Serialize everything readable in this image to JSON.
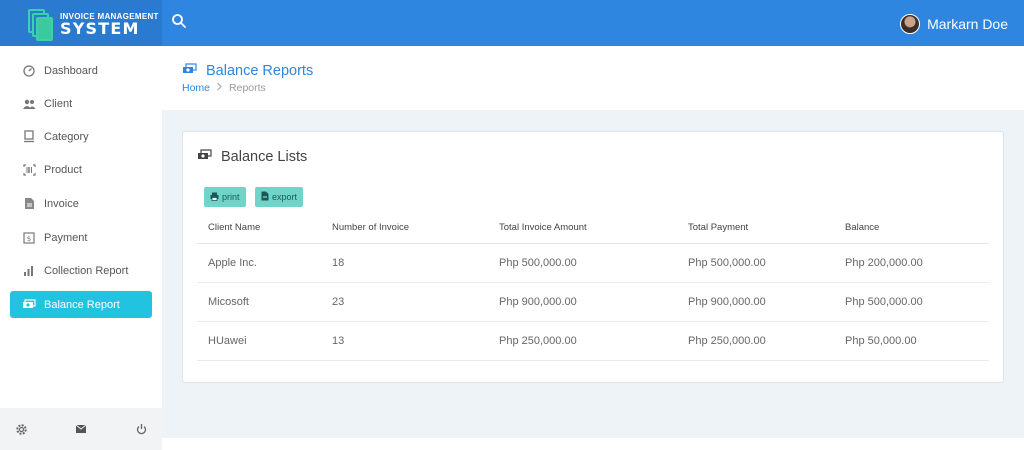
{
  "app": {
    "logo_line1": "Invoice Management",
    "logo_line2": "System"
  },
  "user": {
    "name": "Markarn Doe"
  },
  "sidebar": {
    "items": [
      {
        "label": "Dashboard",
        "icon": "dashboard-icon"
      },
      {
        "label": "Client",
        "icon": "users-icon"
      },
      {
        "label": "Category",
        "icon": "category-icon"
      },
      {
        "label": "Product",
        "icon": "barcode-icon"
      },
      {
        "label": "Invoice",
        "icon": "invoice-icon"
      },
      {
        "label": "Payment",
        "icon": "payment-icon"
      },
      {
        "label": "Collection Report",
        "icon": "chart-icon"
      },
      {
        "label": "Balance Report",
        "icon": "money-icon",
        "active": true
      }
    ],
    "footer_icons": [
      "gear-icon",
      "mail-icon",
      "power-icon"
    ]
  },
  "page": {
    "title": "Balance Reports",
    "breadcrumb_home": "Home",
    "breadcrumb_current": "Reports"
  },
  "card": {
    "title": "Balance Lists",
    "print_label": "print",
    "export_label": "export"
  },
  "table": {
    "headers": [
      "Client Name",
      "Number of Invoice",
      "Total Invoice Amount",
      "Total Payment",
      "Balance"
    ],
    "rows": [
      [
        "Apple Inc.",
        "18",
        "Php 500,000.00",
        "Php 500,000.00",
        "Php 200,000.00"
      ],
      [
        "Micosoft",
        "23",
        "Php 900,000.00",
        "Php 900,000.00",
        "Php 500,000.00"
      ],
      [
        "HUawei",
        "13",
        "Php 250,000.00",
        "Php 250,000.00",
        "Php 50,000.00"
      ]
    ]
  },
  "colors": {
    "topbar": "#2f86e0",
    "accent_active": "#21c3e0",
    "button": "#6fd4c9",
    "logo_green": "#39d3a5"
  }
}
